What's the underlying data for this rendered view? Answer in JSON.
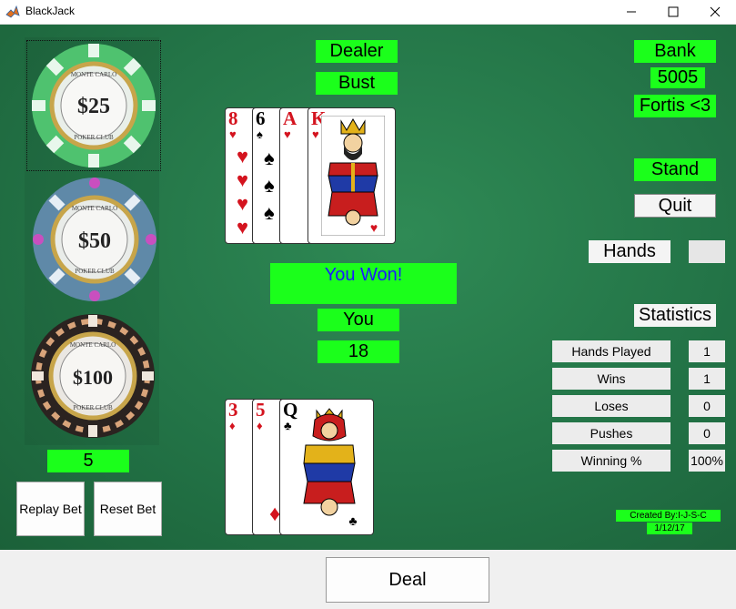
{
  "window": {
    "title": "BlackJack"
  },
  "chips": [
    {
      "value_label": "$25",
      "ring": "MONTE CARLO",
      "bottom": "POKER CLUB",
      "color": "#4fc26f"
    },
    {
      "value_label": "$50",
      "ring": "MONTE CARLO",
      "bottom": "POKER CLUB",
      "color": "#5f89a8"
    },
    {
      "value_label": "$100",
      "ring": "MONTE CARLO",
      "bottom": "POKER CLUB",
      "color": "#2b2320"
    }
  ],
  "bet": {
    "amount": "5"
  },
  "buttons": {
    "replay_bet": "Replay Bet",
    "reset_bet": "Reset Bet",
    "deal": "Deal",
    "stand": "Stand",
    "quit": "Quit"
  },
  "dealer": {
    "label": "Dealer",
    "status": "Bust",
    "cards": [
      {
        "rank": "8",
        "suit": "♥",
        "color": "red"
      },
      {
        "rank": "6",
        "suit": "♠",
        "color": "black"
      },
      {
        "rank": "A",
        "suit": "♥",
        "color": "red"
      },
      {
        "rank": "K",
        "suit": "♥",
        "color": "red",
        "face": true
      }
    ]
  },
  "result": {
    "message": "You Won!"
  },
  "player": {
    "label": "You",
    "total": "18",
    "cards": [
      {
        "rank": "3",
        "suit": "♦",
        "color": "red"
      },
      {
        "rank": "5",
        "suit": "♦",
        "color": "red"
      },
      {
        "rank": "Q",
        "suit": "♣",
        "color": "black",
        "face": true
      }
    ]
  },
  "bank": {
    "label": "Bank",
    "amount": "5005",
    "name": "Fortis <3"
  },
  "hands": {
    "label": "Hands",
    "value": ""
  },
  "statistics": {
    "label": "Statistics",
    "rows": [
      {
        "label": "Hands Played",
        "value": "1"
      },
      {
        "label": "Wins",
        "value": "1"
      },
      {
        "label": "Loses",
        "value": "0"
      },
      {
        "label": "Pushes",
        "value": "0"
      },
      {
        "label": "Winning %",
        "value": "100%"
      }
    ]
  },
  "credits": {
    "created_by": "Created By:I-J-S-C",
    "date": "1/12/17"
  },
  "colors": {
    "felt": "#237447",
    "label_green": "#1bff1b",
    "result_text": "#1a1aff"
  }
}
